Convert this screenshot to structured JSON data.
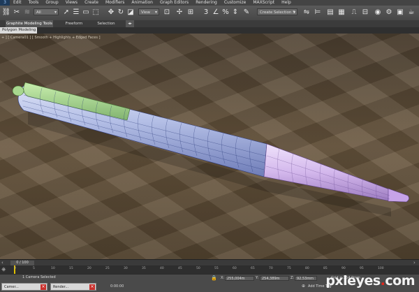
{
  "menubar": {
    "logo": "3",
    "items": [
      "Edit",
      "Tools",
      "Group",
      "Views",
      "Create",
      "Modifiers",
      "Animation",
      "Graph Editors",
      "Rendering",
      "Customize",
      "MAXScript",
      "Help"
    ]
  },
  "toolbar": {
    "selection_filter": "All",
    "ref_coord": "View",
    "named_selection": "Create Selection S"
  },
  "ribbon": {
    "tabs": [
      "Graphite Modeling Tools",
      "Freeform",
      "Selection"
    ],
    "sub_label": "Polygon Modeling"
  },
  "viewport": {
    "label": "+ ] [ Camera01 ] [ Smooth + Highlights + Edged Faces ]",
    "colors": {
      "ground": "#5b4a36",
      "pen_body": "#b9c3e6",
      "cap": "#9ed08a",
      "tip": "#d3b7ec",
      "wire": "#1c2d6e"
    }
  },
  "timeline": {
    "frame_display": "0 / 100",
    "ticks": [
      "0",
      "5",
      "10",
      "15",
      "20",
      "25",
      "30",
      "35",
      "40",
      "45",
      "50",
      "55",
      "60",
      "65",
      "70",
      "75",
      "80",
      "85",
      "90",
      "95",
      "100"
    ]
  },
  "status": {
    "selection": "1 Camera Selected",
    "x_value": "255,004m",
    "y_value": "254,389m",
    "z_value": "92,53mm",
    "grid": "Grid = 254,0mm",
    "add_time_tag": "Add Time Tag",
    "time": "0:00:00",
    "task1": "Camer...",
    "task2": "Render..."
  },
  "watermark": {
    "text": "pxleyes",
    "dot": ".",
    "suffix": "com"
  }
}
